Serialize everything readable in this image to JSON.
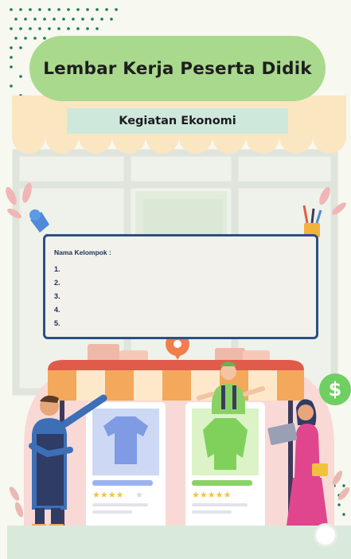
{
  "title": "Lembar Kerja Peserta Didik",
  "subtitle": "Kegiatan Ekonomi",
  "group": {
    "label": "Nama Kelompok :",
    "items": [
      "1.",
      "2.",
      "3.",
      "4.",
      "5."
    ]
  },
  "dollar_sign": "$",
  "colors": {
    "title_bg": "#a9d98d",
    "subtitle_bg": "#cfe8dc",
    "card_border": "#2c4f86",
    "awning_orange": "#f3a85c",
    "awning_cream": "#fde9c9",
    "bottom_band": "#d9eadb"
  },
  "icons": [
    "pushpin-icon",
    "pencil-cup-icon",
    "dollar-bubble-icon",
    "tshirt-icon",
    "sweater-icon",
    "star-icon",
    "location-pin-icon"
  ],
  "ratings": {
    "product_1_stars": 4,
    "product_2_stars": 5
  }
}
